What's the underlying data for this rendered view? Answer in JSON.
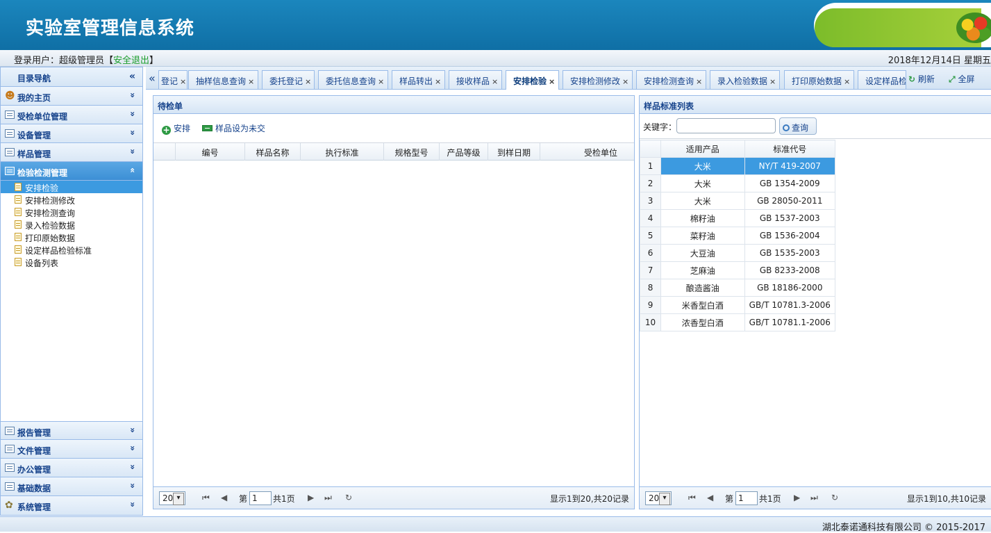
{
  "header": {
    "title": "实验室管理信息系统"
  },
  "userbar": {
    "user_prefix": "登录用户：超级管理员【",
    "logout": "安全退出",
    "user_suffix": "】",
    "date": "2018年12月14日 星期五"
  },
  "sidebar": {
    "title": "目录导航",
    "collapse_glyph": "«",
    "top_groups": [
      {
        "label": "我的主页",
        "arrow": "»"
      },
      {
        "label": "受检单位管理",
        "arrow": "»"
      },
      {
        "label": "设备管理",
        "arrow": "»"
      },
      {
        "label": "样品管理",
        "arrow": "»"
      }
    ],
    "active_group": {
      "label": "检验检测管理",
      "arrow": "«"
    },
    "items": [
      "安排检验",
      "安排检测修改",
      "安排检测查询",
      "录入检验数据",
      "打印原始数据",
      "设定样品检验标准",
      "设备列表"
    ],
    "bottom_groups": [
      {
        "label": "报告管理",
        "arrow": "»"
      },
      {
        "label": "文件管理",
        "arrow": "»"
      },
      {
        "label": "办公管理",
        "arrow": "»"
      },
      {
        "label": "基础数据",
        "arrow": "»"
      },
      {
        "label": "系统管理",
        "arrow": "»"
      }
    ]
  },
  "tabs": {
    "scroll_glyph": "«",
    "items": [
      "登记",
      "抽样信息查询",
      "委托登记",
      "委托信息查询",
      "样品转出",
      "接收样品",
      "安排检验",
      "安排检测修改",
      "安排检测查询",
      "录入检验数据",
      "打印原始数据",
      "设定样品检"
    ],
    "close_glyph": "×",
    "active_tab": "安排检验",
    "refresh": "刷新",
    "fullscreen": "全屏"
  },
  "pending": {
    "title": "待检单",
    "btn_arrange": "安排",
    "btn_unsubmitted": "样品设为未交",
    "columns": [
      "编号",
      "样品名称",
      "执行标准",
      "规格型号",
      "产品等级",
      "到样日期",
      "受检单位"
    ],
    "pager": {
      "size": "20",
      "page_prefix": "第",
      "page": "1",
      "total_pages": "共1页",
      "info": "显示1到20,共20记录"
    }
  },
  "standards": {
    "title": "样品标准列表",
    "keyword_label": "关键字：",
    "keyword_value": "",
    "search_btn": "查询",
    "columns": [
      "适用产品",
      "标准代号"
    ],
    "rows": [
      {
        "n": "1",
        "product": "大米",
        "code": "NY/T 419-2007"
      },
      {
        "n": "2",
        "product": "大米",
        "code": "GB 1354-2009"
      },
      {
        "n": "3",
        "product": "大米",
        "code": "GB 28050-2011"
      },
      {
        "n": "4",
        "product": "棉籽油",
        "code": "GB 1537-2003"
      },
      {
        "n": "5",
        "product": "菜籽油",
        "code": "GB 1536-2004"
      },
      {
        "n": "6",
        "product": "大豆油",
        "code": "GB 1535-2003"
      },
      {
        "n": "7",
        "product": "芝麻油",
        "code": "GB 8233-2008"
      },
      {
        "n": "8",
        "product": "酿造酱油",
        "code": "GB 18186-2000"
      },
      {
        "n": "9",
        "product": "米香型白酒",
        "code": "GB/T 10781.3-2006"
      },
      {
        "n": "10",
        "product": "浓香型白酒",
        "code": "GB/T 10781.1-2006"
      }
    ],
    "pager": {
      "size": "20",
      "page_prefix": "第",
      "page": "1",
      "total_pages": "共1页",
      "info": "显示1到10,共10记录"
    }
  },
  "footer": {
    "copyright": "湖北泰诺通科技有限公司 © 2015-2017"
  },
  "colors": {
    "header_blue": "#1b86bd",
    "selection_blue": "#3c9ae0",
    "accent_green": "#2e9a44"
  }
}
